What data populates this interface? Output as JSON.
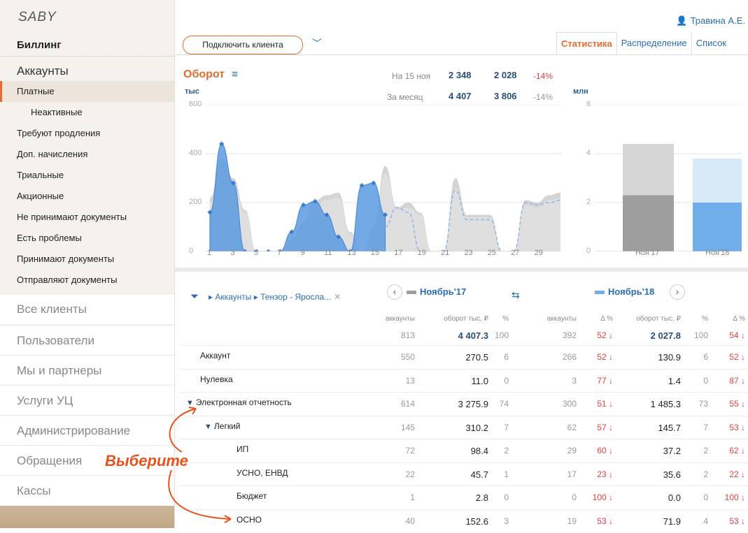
{
  "app": {
    "logo": "SABY",
    "section": "Биллинг"
  },
  "user": {
    "name": "Травина А.Е."
  },
  "sidebar": {
    "accounts_title": "Аккаунты",
    "items": [
      {
        "label": "Платные",
        "active": true
      },
      {
        "label": "Неактивные",
        "sub": true
      },
      {
        "label": "Требуют продления"
      },
      {
        "label": "Доп. начисления"
      },
      {
        "label": "Триальные"
      },
      {
        "label": "Акционные"
      },
      {
        "label": "Не принимают документы"
      },
      {
        "label": "Есть проблемы"
      },
      {
        "label": "Принимают документы"
      },
      {
        "label": "Отправляют документы"
      }
    ],
    "groups": [
      "Все клиенты",
      "Пользователи",
      "Мы и партнеры",
      "Услуги УЦ",
      "Администрирование",
      "Обращения",
      "Кассы"
    ]
  },
  "toolbar": {
    "connect_label": "Подключить клиента"
  },
  "tabs": [
    "Статистика",
    "Распределение",
    "Список"
  ],
  "summary": {
    "title": "Оборот",
    "left_unit": "тыс",
    "right_unit": "млн",
    "rows": [
      {
        "label": "На 15 ноя",
        "v1": "2 348",
        "v2": "2 028",
        "pct": "-14%"
      },
      {
        "label": "За месяц",
        "v1": "4 407",
        "v2": "3 806",
        "pct": "-14%"
      }
    ]
  },
  "chart_data": [
    {
      "type": "area",
      "ylim": [
        0,
        600
      ],
      "yticks": [
        "600",
        "400",
        "200",
        "0"
      ],
      "xticks": [
        "1",
        "3",
        "5",
        "7",
        "9",
        "11",
        "13",
        "15",
        "17",
        "19",
        "21",
        "23",
        "25",
        "27",
        "29"
      ],
      "series": [
        {
          "color": "#cfcfcf",
          "x": [
            1,
            2,
            3,
            4,
            5,
            6,
            7,
            8,
            9,
            10,
            11,
            12,
            13,
            14,
            15,
            16,
            17,
            18,
            19,
            20,
            21,
            22,
            23,
            24,
            25,
            26,
            27,
            28,
            29,
            30,
            31
          ],
          "values": [
            220,
            380,
            300,
            170,
            0,
            0,
            0,
            50,
            120,
            210,
            230,
            240,
            80,
            0,
            100,
            350,
            180,
            200,
            160,
            0,
            0,
            300,
            150,
            150,
            150,
            0,
            0,
            210,
            200,
            230,
            240
          ]
        },
        {
          "color": "#e0e0e0",
          "x": [
            1,
            2,
            3,
            4,
            5,
            6,
            7,
            8,
            9,
            10,
            11,
            12,
            13,
            14,
            15,
            16,
            17,
            18,
            19,
            20,
            21,
            22,
            23,
            24,
            25,
            26,
            27,
            28,
            29,
            30,
            31
          ],
          "values": [
            200,
            340,
            270,
            160,
            0,
            0,
            0,
            40,
            110,
            190,
            210,
            220,
            70,
            0,
            90,
            320,
            170,
            180,
            150,
            0,
            0,
            260,
            140,
            140,
            140,
            0,
            0,
            190,
            180,
            210,
            220
          ]
        },
        {
          "color": "#5b9be0",
          "x": [
            1,
            2,
            3,
            4,
            5,
            6,
            7,
            8,
            9,
            10,
            11,
            12,
            13,
            14,
            15,
            16
          ],
          "values": [
            160,
            440,
            280,
            0,
            0,
            0,
            0,
            80,
            190,
            205,
            150,
            60,
            0,
            270,
            280,
            150
          ]
        },
        {
          "color": "#5b9be0",
          "dashed": true,
          "x": [
            16,
            17,
            18,
            19,
            20,
            21,
            22,
            23,
            24,
            25,
            26,
            27,
            28,
            29,
            30,
            31
          ],
          "values": [
            100,
            180,
            160,
            0,
            0,
            0,
            250,
            130,
            130,
            130,
            0,
            0,
            200,
            190,
            200,
            210
          ]
        }
      ]
    },
    {
      "type": "bar",
      "ylim": [
        0,
        6
      ],
      "yticks": [
        "6",
        "4",
        "2",
        "0"
      ],
      "categories": [
        "Ноя'17",
        "Ноя'18"
      ],
      "series": [
        {
          "values": [
            2.3,
            2.0
          ],
          "colors": [
            "#9e9e9e",
            "#6faee8"
          ]
        },
        {
          "values": [
            2.1,
            1.8
          ],
          "colors": [
            "#d6d6d6",
            "#d8eaf7"
          ]
        }
      ]
    }
  ],
  "table": {
    "breadcrumb": "▸ Аккаунты ▸ Тензор - Яросла...",
    "period_left": "Ноябрь'17",
    "period_right": "Ноябрь'18",
    "headers": [
      "аккаунты",
      "оборот тыс, ₽",
      "%",
      "аккаунты",
      "Δ %",
      "оборот тыс, ₽",
      "%",
      "Δ %"
    ],
    "totals": [
      "813",
      "4 407.3",
      "100",
      "392",
      "52 ↓",
      "2 027.8",
      "100",
      "54 ↓"
    ],
    "rows": [
      {
        "name": "Аккаунт",
        "indent": 0,
        "vals": [
          "550",
          "270.5",
          "6",
          "266",
          "52 ↓",
          "130.9",
          "6",
          "52 ↓"
        ]
      },
      {
        "name": "Нулевка",
        "indent": 0,
        "vals": [
          "13",
          "11.0",
          "0",
          "3",
          "77 ↓",
          "1.4",
          "0",
          "87 ↓"
        ]
      },
      {
        "name": "Электронная отчетность",
        "indent": 0,
        "expanded": true,
        "vals": [
          "614",
          "3 275.9",
          "74",
          "300",
          "51 ↓",
          "1 485.3",
          "73",
          "55 ↓"
        ]
      },
      {
        "name": "Легкий",
        "indent": 1,
        "expanded": true,
        "vals": [
          "145",
          "310.2",
          "7",
          "62",
          "57 ↓",
          "145.7",
          "7",
          "53 ↓"
        ]
      },
      {
        "name": "ИП",
        "indent": 2,
        "vals": [
          "72",
          "98.4",
          "2",
          "29",
          "60 ↓",
          "37.2",
          "2",
          "62 ↓"
        ]
      },
      {
        "name": "УСНО, ЕНВД",
        "indent": 2,
        "vals": [
          "22",
          "45.7",
          "1",
          "17",
          "23 ↓",
          "35.6",
          "2",
          "22 ↓"
        ]
      },
      {
        "name": "Бюджет",
        "indent": 2,
        "vals": [
          "1",
          "2.8",
          "0",
          "0",
          "100 ↓",
          "0.0",
          "0",
          "100 ↓"
        ]
      },
      {
        "name": "ОСНО",
        "indent": 2,
        "vals": [
          "40",
          "152.6",
          "3",
          "19",
          "53 ↓",
          "71.9",
          "4",
          "53 ↓"
        ]
      }
    ]
  },
  "annotation": {
    "text": "Выберите"
  }
}
